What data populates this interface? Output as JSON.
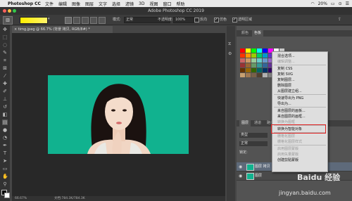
{
  "menubar": {
    "app_name": "Photoshop CC",
    "items": [
      "文件",
      "编辑",
      "图像",
      "图层",
      "文字",
      "选择",
      "滤镜",
      "3D",
      "视图",
      "窗口",
      "帮助"
    ],
    "battery": "20%",
    "extras": [
      "⊙",
      "☰"
    ]
  },
  "window": {
    "title": "Adobe Photoshop CC 2019"
  },
  "options": {
    "mode_label": "模式:",
    "mode_value": "正常",
    "opacity_label": "不透明度:",
    "opacity_value": "100%",
    "reverse_label": "反向",
    "dither_label": "仿色",
    "transparency_label": "透明区域"
  },
  "document": {
    "tab_label": "timg.jpeg @ 66.7% (背景 拷贝, RGB/8#) *",
    "zoom": "66.67%",
    "status": "文档:784.3K/784.3K"
  },
  "panels": {
    "top_tabs": [
      "颜色",
      "色板"
    ],
    "mid_tabs": [
      "图层",
      "通道",
      "路径"
    ],
    "layer_mode": "正常",
    "layer_kind": "类型",
    "lock_label": "锁定:",
    "layers": [
      "图层 拷贝",
      "图层"
    ]
  },
  "context_menu": {
    "items": [
      {
        "label": "混合选项...",
        "disabled": false
      },
      {
        "label": "编辑调整...",
        "disabled": true
      },
      {
        "label": "复制 CSS",
        "disabled": false
      },
      {
        "label": "复制 SVG",
        "disabled": false
      },
      {
        "label": "复制图层...",
        "disabled": false
      },
      {
        "label": "删除图层",
        "disabled": false
      },
      {
        "label": "从图层建立组...",
        "disabled": false
      },
      {
        "label": "快速导出为 PNG",
        "disabled": false
      },
      {
        "label": "导出为...",
        "disabled": false
      },
      {
        "label": "来自图层的画板...",
        "disabled": false
      },
      {
        "label": "来自图层的画框...",
        "disabled": false
      },
      {
        "label": "转换为图框",
        "disabled": true
      },
      {
        "label": "转换为智能对象",
        "disabled": false,
        "highlighted": true
      },
      {
        "label": "栅格化图层",
        "disabled": true
      },
      {
        "label": "栅格化图层样式",
        "disabled": true
      },
      {
        "label": "启用图层蒙版",
        "disabled": true
      },
      {
        "label": "启用矢量蒙版",
        "disabled": true
      },
      {
        "label": "创建剪贴蒙版",
        "disabled": false
      }
    ]
  },
  "watermark": {
    "brand": "Baidu 经验",
    "url": "jingyan.baidu.com"
  },
  "colors": {
    "accent_red": "#e02020",
    "photo_bg": "#11b28f",
    "foreground_swatch": "#ffee00",
    "mac_close": "#fc605c",
    "mac_min": "#fdbc40",
    "mac_max": "#34c84a"
  }
}
